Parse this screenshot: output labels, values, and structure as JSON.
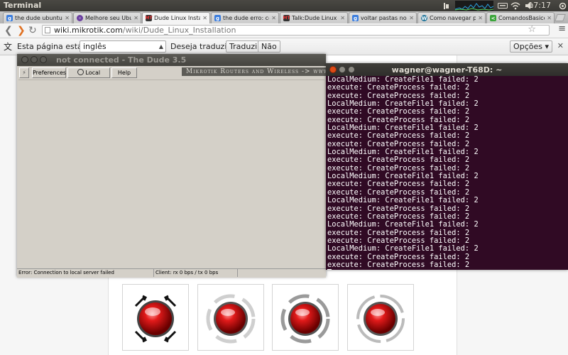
{
  "top_panel": {
    "app_title": "Terminal",
    "clock": "17:17"
  },
  "browser": {
    "tabs": [
      {
        "title": "the dude ubuntu -",
        "favicon": "google-icon",
        "active": false
      },
      {
        "title": "Melhore seu Ubun",
        "favicon": "ubuntu-icon",
        "active": false
      },
      {
        "title": "Dude Linux Installa",
        "favicon": "mikrotik-icon",
        "active": true
      },
      {
        "title": "the dude erro: con",
        "favicon": "google-icon",
        "active": false
      },
      {
        "title": "Talk:Dude Linux In",
        "favicon": "mikrotik-icon",
        "active": false
      },
      {
        "title": "voltar pastas no te",
        "favicon": "google-icon",
        "active": false
      },
      {
        "title": "Como navegar pelo",
        "favicon": "wordpress-icon",
        "active": false
      },
      {
        "title": "ComandosBasicos -",
        "favicon": "green-icon",
        "active": false
      }
    ],
    "address": {
      "host": "wiki.mikrotik.com",
      "path": "/wiki/Dude_Linux_Installation"
    },
    "translate_bar": {
      "label": "Esta página está em",
      "language": "inglês",
      "question": "Deseja traduzi-la?",
      "translate_button": "Traduzir",
      "no_button": "Não",
      "options_button": "Opções"
    }
  },
  "dude_window": {
    "title": "not connected - The Dude 3.5",
    "toolbar": {
      "preferences": "Preferences",
      "local_server": "Local Server",
      "help": "Help"
    },
    "banner": "Mikrotik Routers and Wireless -> www",
    "status": {
      "error": "Error: Connection to local server failed",
      "client": "Client: rx 0 bps / tx 0 bps"
    }
  },
  "terminal_window": {
    "title": "wagner@wagner-T68D: ~",
    "lines": [
      "LocalMedium: CreateFile1 failed: 2",
      "execute: CreateProcess failed: 2",
      "execute: CreateProcess failed: 2",
      "LocalMedium: CreateFile1 failed: 2",
      "execute: CreateProcess failed: 2",
      "execute: CreateProcess failed: 2",
      "LocalMedium: CreateFile1 failed: 2",
      "execute: CreateProcess failed: 2",
      "execute: CreateProcess failed: 2",
      "LocalMedium: CreateFile1 failed: 2",
      "execute: CreateProcess failed: 2",
      "execute: CreateProcess failed: 2",
      "LocalMedium: CreateFile1 failed: 2",
      "execute: CreateProcess failed: 2",
      "execute: CreateProcess failed: 2",
      "LocalMedium: CreateFile1 failed: 2",
      "execute: CreateProcess failed: 2",
      "execute: CreateProcess failed: 2",
      "LocalMedium: CreateFile1 failed: 2",
      "execute: CreateProcess failed: 2",
      "execute: CreateProcess failed: 2",
      "LocalMedium: CreateFile1 failed: 2",
      "execute: CreateProcess failed: 2",
      "execute: CreateProcess failed: 2"
    ]
  },
  "webpage": {
    "thumbnails": [
      "red-button-black-arrows-icon",
      "red-button-gray-arrows-icon",
      "red-button-gray-arrows-icon",
      "red-button-circular-arrows-icon"
    ]
  },
  "colors": {
    "terminal_bg": "#300a24",
    "dude_bg": "#d4d0c8",
    "ubuntu_close": "#df4a16"
  }
}
